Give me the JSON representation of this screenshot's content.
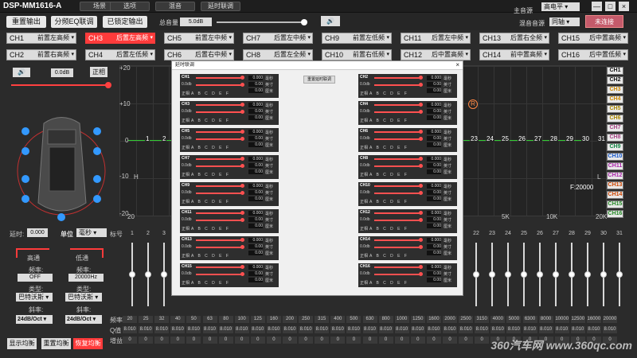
{
  "app": {
    "title": "DSP-MM1616-A"
  },
  "menu": [
    {
      "label": "场景"
    },
    {
      "label": "选项"
    },
    {
      "label": "混音"
    },
    {
      "label": "延时联调"
    }
  ],
  "window": {
    "mode": "高电平",
    "min": "—",
    "max": "□",
    "close": "×"
  },
  "toolbar": {
    "reset_output": "重置输出",
    "eq_link": "分频EQ联调",
    "lock_output": "已锁定输出",
    "volume_label": "总音量",
    "volume_value": "5.0dB",
    "mix_source_label": "混音音源",
    "mix_source": "同轴",
    "main_source_label": "主音源",
    "connect": "未连接"
  },
  "channels_row1": [
    {
      "ch": "CH1",
      "pos": "前置左高频"
    },
    {
      "ch": "CH3",
      "pos": "后置左高频"
    },
    {
      "ch": "CH5",
      "pos": "前置左中频"
    },
    {
      "ch": "CH7",
      "pos": "后置左中频"
    },
    {
      "ch": "CH9",
      "pos": "前置左低频"
    },
    {
      "ch": "CH11",
      "pos": "后置左中频"
    },
    {
      "ch": "CH13",
      "pos": "后置右全频"
    },
    {
      "ch": "CH15",
      "pos": "后中置高频"
    }
  ],
  "channels_row2": [
    {
      "ch": "CH2",
      "pos": "前置右高频"
    },
    {
      "ch": "CH4",
      "pos": "后置左低频"
    },
    {
      "ch": "CH6",
      "pos": "后置右中频"
    },
    {
      "ch": "CH8",
      "pos": "后置左全频"
    },
    {
      "ch": "CH10",
      "pos": "前置右低频"
    },
    {
      "ch": "CH12",
      "pos": "后中置高频"
    },
    {
      "ch": "CH14",
      "pos": "前中置高频"
    },
    {
      "ch": "CH16",
      "pos": "后中置低频"
    }
  ],
  "left": {
    "gain": "0.0dB",
    "phase": "正相",
    "delay_label": "延时:",
    "delay_value": "0.000",
    "unit_label": "单位",
    "unit": "毫秒",
    "mark_label": "标号",
    "hp_label": "高通",
    "lp_label": "低通",
    "freq_label": "频率:",
    "hp_freq": "OFF",
    "lp_freq": "20000Hz",
    "type_label": "类型:",
    "hp_type": "巴特沃斯",
    "lp_type": "巴特沃斯",
    "slope_label": "斜率:",
    "hp_slope": "24dB/Oct",
    "lp_slope": "24dB/Oct",
    "btn_show": "显示均衡",
    "btn_reset": "重置均衡",
    "btn_restore": "恢复均衡"
  },
  "plot": {
    "y_labels": [
      "+20",
      "+10",
      "0",
      "-10",
      "-20"
    ],
    "x_labels": [
      "20",
      "5K",
      "10K",
      "20K"
    ],
    "h_label": "H",
    "l_label": "L",
    "freq_label": "F:20000",
    "points": [
      "1",
      "2",
      "3",
      "23",
      "24",
      "25",
      "26",
      "27",
      "28",
      "29",
      "30",
      "31"
    ]
  },
  "chlist": [
    {
      "ch": "CH1",
      "color": "#111111"
    },
    {
      "ch": "CH2",
      "color": "#111111"
    },
    {
      "ch": "CH3",
      "color": "#cc8800"
    },
    {
      "ch": "CH4",
      "color": "#cc8800"
    },
    {
      "ch": "CH5",
      "color": "#aa8800"
    },
    {
      "ch": "CH6",
      "color": "#aa8800"
    },
    {
      "ch": "CH7",
      "color": "#aa4488"
    },
    {
      "ch": "CH8",
      "color": "#aa4488"
    },
    {
      "ch": "CH9",
      "color": "#118844"
    },
    {
      "ch": "CH10",
      "color": "#1155cc"
    },
    {
      "ch": "CH11",
      "color": "#aa22aa"
    },
    {
      "ch": "CH12",
      "color": "#aa22aa"
    },
    {
      "ch": "CH13",
      "color": "#cc4400"
    },
    {
      "ch": "CH14",
      "color": "#cc4400"
    },
    {
      "ch": "CH15",
      "color": "#228822"
    },
    {
      "ch": "CH16",
      "color": "#228822"
    }
  ],
  "bands": {
    "numbers": [
      "1",
      "2",
      "3",
      "22",
      "23",
      "24",
      "25",
      "26",
      "27",
      "28",
      "29",
      "30",
      "31"
    ],
    "row_freq_label": "频率",
    "row_q_label": "Q值",
    "row_gain_label": "增益",
    "freq": [
      "20",
      "25",
      "32",
      "40",
      "50",
      "63",
      "80",
      "100",
      "125",
      "160",
      "200",
      "250",
      "315",
      "400",
      "500",
      "630",
      "800",
      "1000",
      "1250",
      "1600",
      "2000",
      "2500",
      "3150",
      "4000",
      "5000",
      "6300",
      "8000",
      "10000",
      "12500",
      "16000",
      "20000"
    ],
    "q": "8.010",
    "gain": "0"
  },
  "dialog": {
    "title": "延时联调",
    "close": "×",
    "reset": "重置延时联调",
    "units": [
      "毫秒",
      "英寸",
      "厘米"
    ],
    "vals": [
      "0.000",
      "0.00",
      "0.00"
    ],
    "db": "0.0db",
    "phase": "正相",
    "letters": "A B C D E F",
    "channels": [
      "CH1",
      "CH2",
      "CH3",
      "CH4",
      "CH5",
      "CH6",
      "CH7",
      "CH8",
      "CH9",
      "CH10",
      "CH11",
      "CH12",
      "CH13",
      "CH14",
      "CH15",
      "CH16"
    ]
  },
  "watermark": "360汽车网 www.360qc.com"
}
